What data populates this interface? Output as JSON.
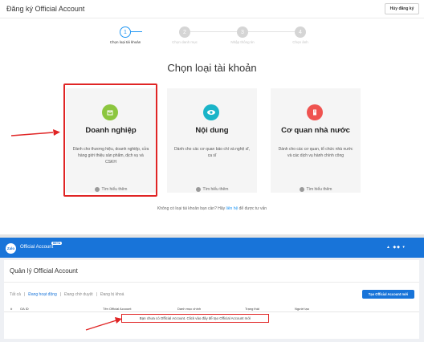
{
  "page": {
    "title": "Đăng ký Official Account",
    "cancel_label": "Hủy đăng ký"
  },
  "steps": [
    {
      "num": "1",
      "label": "Chọn loại tài khoản",
      "state": "active"
    },
    {
      "num": "2",
      "label": "Chọn danh mục",
      "state": "inactive"
    },
    {
      "num": "3",
      "label": "Nhập thông tin",
      "state": "inactive"
    },
    {
      "num": "4",
      "label": "Chọn ảnh",
      "state": "inactive"
    }
  ],
  "heading": "Chọn loại tài khoản",
  "cards": [
    {
      "title": "Doanh nghiệp",
      "desc": "Dành cho thương hiệu, doanh nghiệp, cửa hàng giới thiệu sản phẩm, dịch vụ và CSKH",
      "more": "Tìm hiểu thêm",
      "icon": "shop-icon",
      "color": "#8cc63f"
    },
    {
      "title": "Nội dung",
      "desc": "Dành cho các cơ quan báo chí và nghệ sĩ, ca sĩ",
      "more": "Tìm hiểu thêm",
      "icon": "eye-icon",
      "color": "#1ab4c8"
    },
    {
      "title": "Cơ quan nhà nước",
      "desc": "Dành cho các cơ quan, tổ chức nhà nước và các dịch vụ hành chính công",
      "more": "Tìm hiểu thêm",
      "icon": "building-icon",
      "color": "#ef5350"
    }
  ],
  "note": {
    "before": "Không có loại tài khoản bạn cần? Hãy ",
    "link": "liên hệ",
    "after": " để được tư vấn"
  },
  "zalo_bar": {
    "logo": "Zalo",
    "name": "Official Account",
    "badge": "BETA",
    "right": "▲ ◆◆ ▾"
  },
  "manage": {
    "title": "Quản lý Official Account",
    "tabs": [
      {
        "label": "Tất cả",
        "active": false
      },
      {
        "label": "Đang hoạt động",
        "active": true
      },
      {
        "label": "Đang chờ duyệt",
        "active": false
      },
      {
        "label": "Đang bị khoá",
        "active": false
      }
    ],
    "create_label": "Tạo Official Account mới",
    "columns": [
      "#",
      "OA ID",
      "Tên Official Account",
      "Danh mục chính",
      "Trạng thái",
      "Người tạo"
    ],
    "empty_text": "Bạn chưa có Official Account. Click vào đây để tạo Official Account mới"
  },
  "colors": {
    "accent": "#2196f3",
    "zalo_blue": "#1874d9",
    "highlight": "#e02525"
  }
}
